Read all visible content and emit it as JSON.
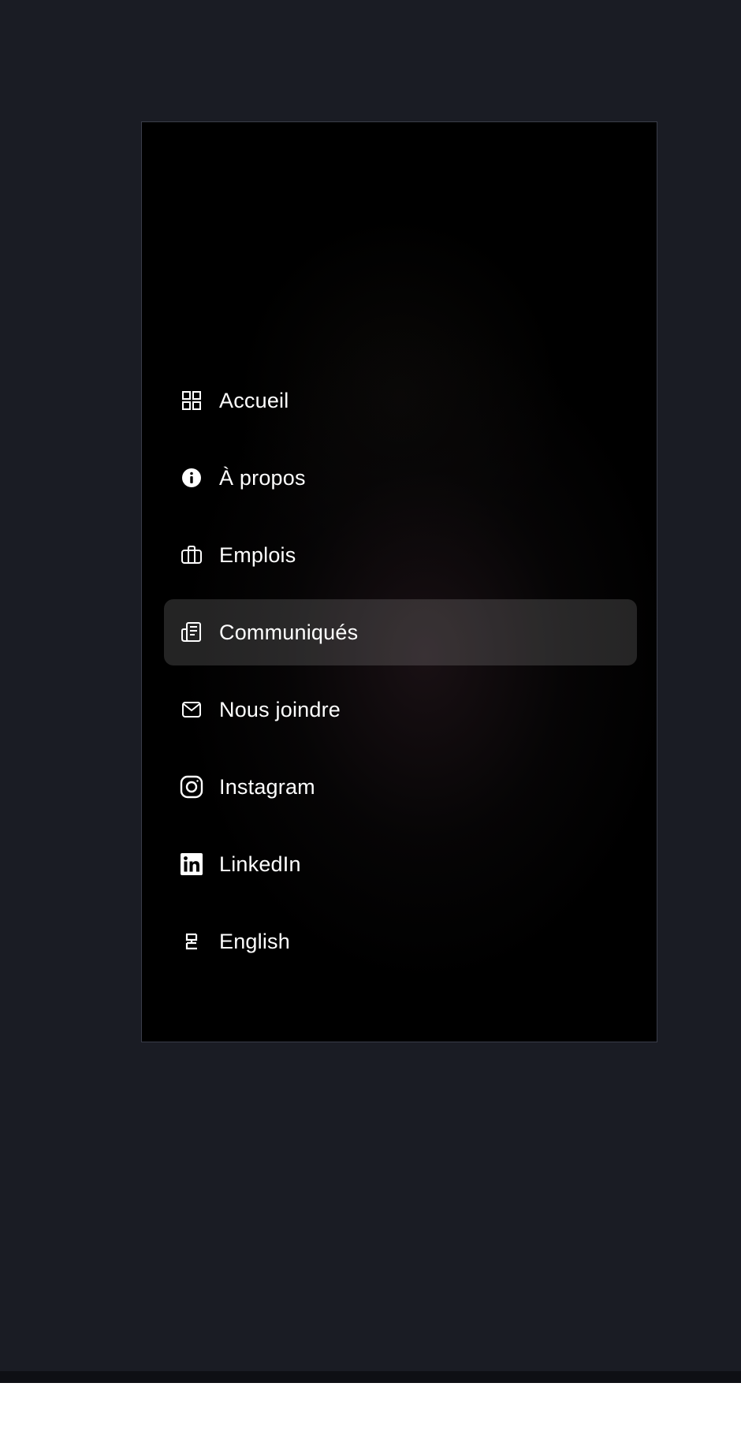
{
  "menu": {
    "items": [
      {
        "label": "Accueil",
        "icon": "grid-icon",
        "active": false
      },
      {
        "label": "À propos",
        "icon": "info-icon",
        "active": false
      },
      {
        "label": "Emplois",
        "icon": "briefcase-icon",
        "active": false
      },
      {
        "label": "Communiqués",
        "icon": "newspaper-icon",
        "active": true
      },
      {
        "label": "Nous joindre",
        "icon": "mail-icon",
        "active": false
      },
      {
        "label": "Instagram",
        "icon": "instagram-icon",
        "active": false
      },
      {
        "label": "LinkedIn",
        "icon": "linkedin-icon",
        "active": false
      },
      {
        "label": "English",
        "icon": "language-icon",
        "active": false
      }
    ]
  },
  "colors": {
    "backdrop": "#1a1c24",
    "panel": "#000000",
    "text": "#ffffff",
    "active_bg": "rgba(255,255,255,0.14)"
  }
}
